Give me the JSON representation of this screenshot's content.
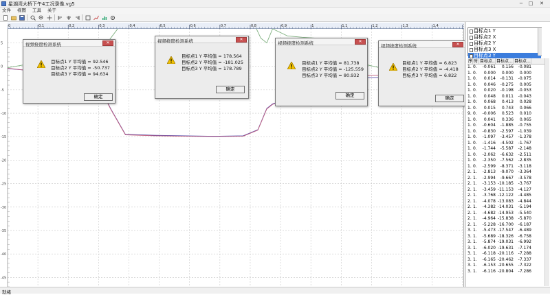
{
  "app": {
    "title": "星湖湾大桥下午4工况录像.vg5",
    "icon": "app-icon"
  },
  "window_controls": {
    "minimize": "─",
    "maximize": "□",
    "close": "✕"
  },
  "menu": [
    "文件",
    "视图",
    "工具",
    "关于"
  ],
  "toolbar": {
    "icons": [
      "new-file-icon",
      "open-folder-icon",
      "save-icon",
      "zoom-in-icon",
      "zoom-out-icon",
      "pan-icon",
      "align-left-icon",
      "align-center-icon",
      "align-right-icon",
      "fit-icon",
      "chart-icon",
      "stats-icon",
      "settings-icon"
    ]
  },
  "ruler": {
    "labels": [
      "0",
      "0.1",
      "0.2",
      "0.3",
      "0.4",
      "0.5",
      "0.6",
      "0.7",
      "0.8",
      "0.9",
      "1",
      "1.1",
      "1.2",
      "1.3",
      "1.4",
      "1.5"
    ]
  },
  "y_axis": {
    "labels": [
      "5",
      "0",
      "-5",
      "-10",
      "-15",
      "-20",
      "-25",
      "-30",
      "-35",
      "-40",
      "-45"
    ]
  },
  "chart_data": {
    "type": "line",
    "series": [
      {
        "name": "目标点1 Y",
        "color": "#7fb07f",
        "x": [
          0,
          0.1,
          0.2,
          0.3,
          0.35,
          0.4,
          0.5,
          0.6,
          0.7,
          0.8,
          0.83,
          0.86,
          0.88,
          0.9,
          0.95,
          1.0,
          1.1,
          1.15,
          1.2,
          1.3,
          1.4,
          1.45,
          1.5,
          1.55
        ],
        "y": [
          -0.3,
          0.8,
          1.2,
          1.6,
          6.0,
          10.2,
          10.6,
          10.7,
          10.9,
          10.8,
          10.0,
          6.0,
          5.0,
          8.0,
          6.5,
          6.2,
          5.8,
          5.5,
          0.6,
          -0.8,
          0.0,
          -0.3,
          -0.2,
          -0.1
        ]
      },
      {
        "name": "目标点2 Y",
        "color": "#5a4aa8",
        "x": [
          0,
          0.1,
          0.2,
          0.3,
          0.35,
          0.4,
          0.5,
          0.6,
          0.7,
          0.8,
          0.85,
          0.88,
          0.9,
          0.95,
          1.0,
          1.1,
          1.15,
          1.2,
          1.3,
          1.4,
          1.45,
          1.5,
          1.55
        ],
        "y": [
          -0.5,
          -1.0,
          -2.0,
          -2.8,
          -9.0,
          -14.5,
          -14.7,
          -14.8,
          -14.9,
          -14.8,
          -13.5,
          -9.0,
          -8.0,
          -7.0,
          -6.8,
          -6.2,
          -4.0,
          -2.5,
          -2.3,
          -2.0,
          -1.2,
          -0.8,
          -0.6
        ]
      },
      {
        "name": "目标点3 Y",
        "color": "#c06080",
        "x": [
          0,
          0.1,
          0.2,
          0.3,
          0.35,
          0.4,
          0.5,
          0.6,
          0.7,
          0.8,
          0.85,
          0.88,
          0.9,
          0.95,
          1.0,
          1.1,
          1.15,
          1.2,
          1.3,
          1.4,
          1.45,
          1.5,
          1.55
        ],
        "y": [
          -0.4,
          -1.1,
          -2.1,
          -2.9,
          -9.1,
          -14.6,
          -14.8,
          -14.9,
          -15.0,
          -14.9,
          -13.6,
          -9.1,
          -8.1,
          -7.1,
          -6.9,
          -6.3,
          -4.1,
          -2.0,
          -1.8,
          -1.9,
          -1.0,
          -0.7,
          -0.5
        ]
      }
    ],
    "xlim": [
      0,
      1.55
    ],
    "ylim": [
      -47,
      8
    ],
    "grid": true
  },
  "dialogs": [
    {
      "title": "视频挠度检测系统",
      "lines": [
        "目标点1 Y  平均值 = 92.546",
        "目标点2 Y  平均值 = -50.737",
        "目标点3 Y  平均值 = 94.634"
      ],
      "ok": "确定",
      "close": "✕"
    },
    {
      "title": "视频挠度检测系统",
      "lines": [
        "目标点1 Y  平均值 = 178.564",
        "目标点2 Y  平均值 = -181.025",
        "目标点3 Y  平均值 = 178.789"
      ],
      "ok": "确定",
      "close": "✕"
    },
    {
      "title": "视频挠度检测系统",
      "lines": [
        "目标点1 Y  平均值 = 81.738",
        "目标点2 Y  平均值 = -125.559",
        "目标点3 Y  平均值 = 80.932"
      ],
      "ok": "确定",
      "close": "✕"
    },
    {
      "title": "视频挠度检测系统",
      "lines": [
        "目标点1 Y  平均值 = 6.823",
        "目标点2 Y  平均值 = -4.418",
        "目标点3 Y  平均值 = 6.822"
      ],
      "ok": "确定",
      "close": "✕"
    }
  ],
  "legend": [
    {
      "label": "目标点1 Y",
      "selected": false
    },
    {
      "label": "目标点2 X",
      "selected": false
    },
    {
      "label": "目标点2 Y",
      "selected": false
    },
    {
      "label": "目标点3 X",
      "selected": false
    },
    {
      "label": "目标点3 Y",
      "selected": true
    }
  ],
  "table": {
    "headers": [
      "序",
      "时",
      "目标点...",
      "目标点...",
      "目标点..."
    ],
    "rows": [
      [
        "1.",
        "0.",
        "-0.061",
        "0.156",
        "-0.081"
      ],
      [
        "1.",
        "0.",
        "0.000",
        "0.000",
        "0.000"
      ],
      [
        "1.",
        "0.",
        "0.014",
        "-0.131",
        "-0.075"
      ],
      [
        "1.",
        "0.",
        "0.046",
        "-0.275",
        "0.005"
      ],
      [
        "1.",
        "0.",
        "0.020",
        "-0.198",
        "-0.053"
      ],
      [
        "1.",
        "0.",
        "0.048",
        "0.011",
        "-0.043"
      ],
      [
        "1.",
        "0.",
        "0.068",
        "0.413",
        "0.028"
      ],
      [
        "1.",
        "0.",
        "0.015",
        "0.743",
        "0.066"
      ],
      [
        "9.",
        "0.",
        "-0.006",
        "0.523",
        "0.010"
      ],
      [
        "1.",
        "0.",
        "0.041",
        "0.336",
        "0.065"
      ],
      [
        "1.",
        "0.",
        "-0.604",
        "-1.885",
        "-0.755"
      ],
      [
        "1.",
        "0.",
        "-0.830",
        "-2.597",
        "-1.039"
      ],
      [
        "1.",
        "0.",
        "-1.097",
        "-3.457",
        "-1.378"
      ],
      [
        "1.",
        "0.",
        "-1.416",
        "-4.502",
        "-1.767"
      ],
      [
        "1.",
        "0.",
        "-1.744",
        "-5.587",
        "-2.148"
      ],
      [
        "1.",
        "0.",
        "-2.062",
        "-6.632",
        "-2.511"
      ],
      [
        "1.",
        "0.",
        "-2.350",
        "-7.562",
        "-2.835"
      ],
      [
        "1.",
        "0.",
        "-2.599",
        "-8.371",
        "-3.118"
      ],
      [
        "2.",
        "1.",
        "-2.813",
        "-9.070",
        "-3.364"
      ],
      [
        "2.",
        "1.",
        "-2.994",
        "-9.667",
        "-3.578"
      ],
      [
        "2.",
        "1.",
        "-3.153",
        "-10.185",
        "-3.767"
      ],
      [
        "2.",
        "1.",
        "-3.459",
        "-11.153",
        "-4.127"
      ],
      [
        "2.",
        "1.",
        "-3.768",
        "-12.122",
        "-4.485"
      ],
      [
        "2.",
        "1.",
        "-4.078",
        "-13.083",
        "-4.844"
      ],
      [
        "2.",
        "1.",
        "-4.382",
        "-14.031",
        "-5.194"
      ],
      [
        "2.",
        "1.",
        "-4.682",
        "-14.953",
        "-5.540"
      ],
      [
        "2.",
        "1.",
        "-4.964",
        "-15.838",
        "-5.870"
      ],
      [
        "2.",
        "1.",
        "-5.228",
        "-16.700",
        "-6.187"
      ],
      [
        "3.",
        "1.",
        "-5.473",
        "-17.547",
        "-6.489"
      ],
      [
        "3.",
        "1.",
        "-5.689",
        "-18.326",
        "-6.758"
      ],
      [
        "3.",
        "1.",
        "-5.874",
        "-19.031",
        "-6.992"
      ],
      [
        "3.",
        "1.",
        "-6.020",
        "-19.631",
        "-7.174"
      ],
      [
        "3.",
        "1.",
        "-6.118",
        "-20.116",
        "-7.288"
      ],
      [
        "3.",
        "1.",
        "-6.165",
        "-20.462",
        "-7.337"
      ],
      [
        "3.",
        "1.",
        "-6.153",
        "-20.655",
        "-7.322"
      ],
      [
        "3.",
        "1.",
        "-6.116",
        "-20.804",
        "-7.286"
      ]
    ]
  },
  "status": {
    "text": "就绪"
  }
}
